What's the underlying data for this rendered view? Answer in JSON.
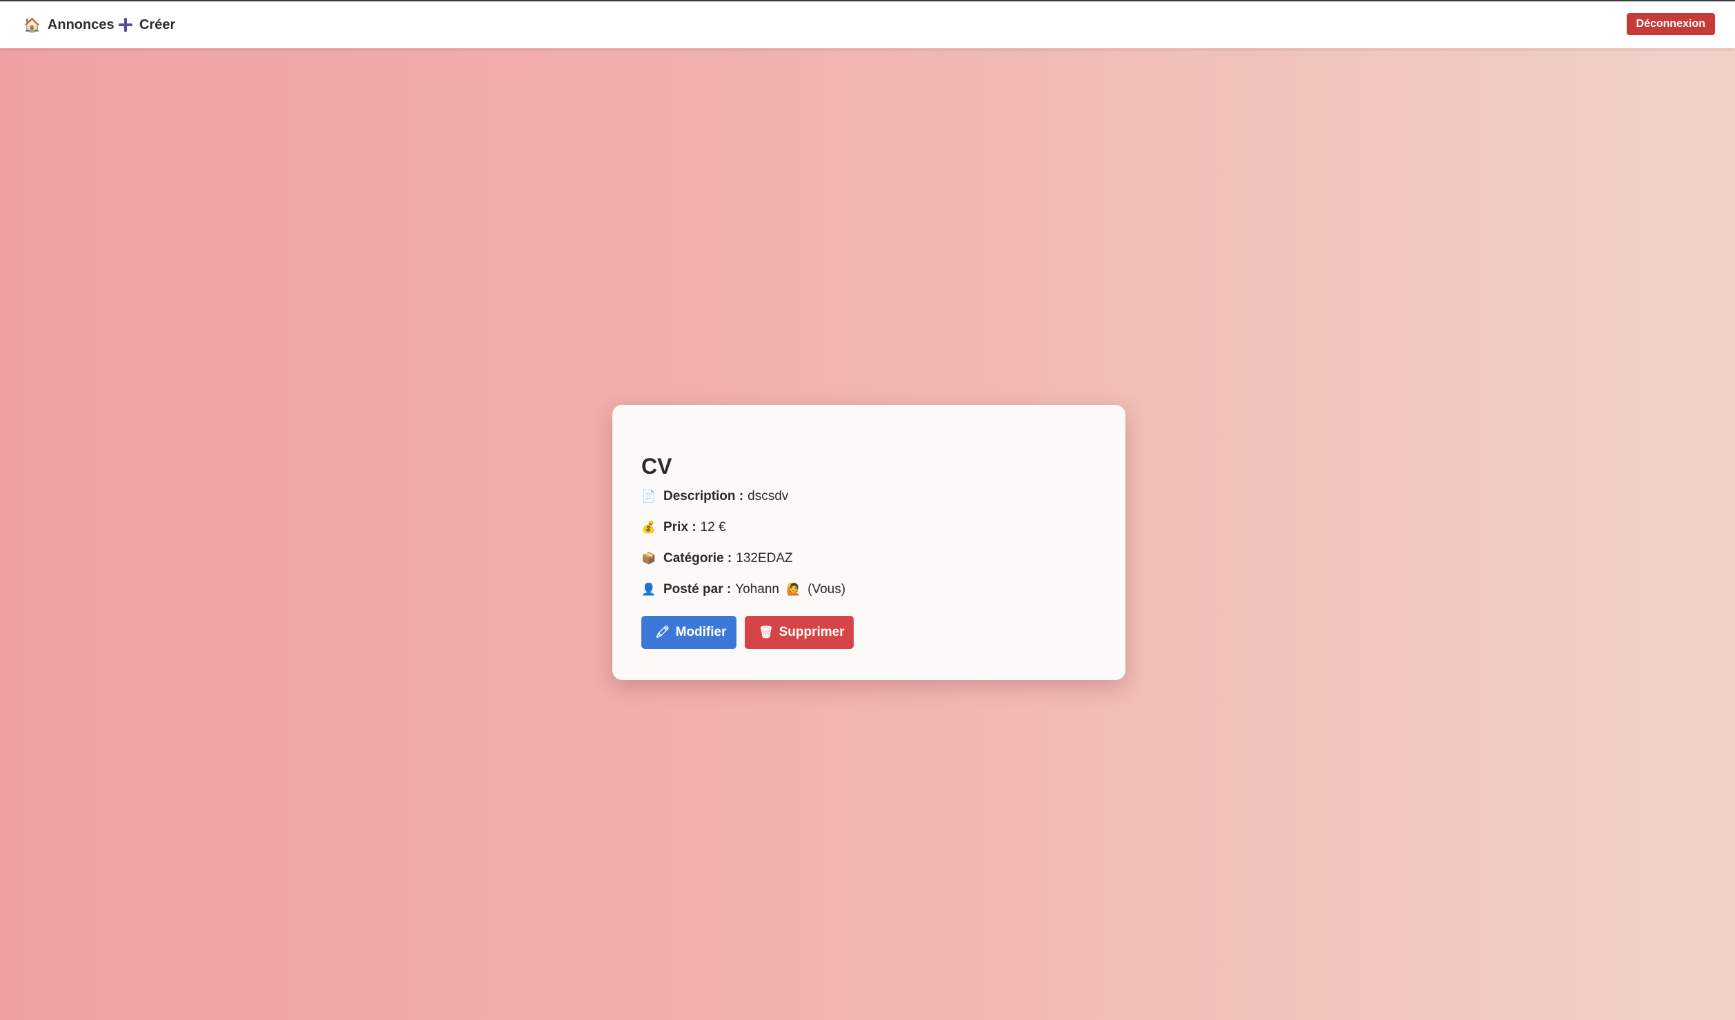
{
  "navbar": {
    "annonces_icon": "🏠",
    "annonces_label": "Annonces",
    "creer_label": "Créer",
    "logout_label": "Déconnexion"
  },
  "listing": {
    "title": "CV",
    "description": {
      "icon": "📄",
      "label": "Description :",
      "value": "dscsdv"
    },
    "price": {
      "icon": "💰",
      "label": "Prix :",
      "value": "12 €"
    },
    "category": {
      "icon": "📦",
      "label": "Catégorie :",
      "value": "132EDAZ"
    },
    "posted_by": {
      "icon": "👤",
      "label": "Posté par :",
      "value": "Yohann",
      "badge_icon": "🙋",
      "suffix": "(Vous)"
    }
  },
  "actions": {
    "edit_icon": "🖍",
    "edit_label": "Modifier",
    "delete_icon": "🗑",
    "delete_label": "Supprimer"
  },
  "colors": {
    "edit_button": "#3c78d8",
    "delete_button": "#d64545",
    "logout_button": "#c63a3a"
  }
}
